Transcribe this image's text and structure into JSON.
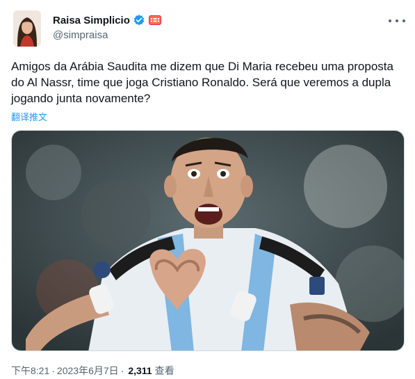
{
  "author": {
    "display_name": "Raisa Simplicio",
    "handle": "@simpraisa",
    "verified_icon": "verified-badge-icon",
    "affiliation_icon": "affiliate-badge-icon"
  },
  "tweet": {
    "text": "Amigos da Arábia Saudita me dizem que Di Maria recebeu uma proposta\ndo Al Nassr, time que joga Cristiano Ronaldo. Será que veremos a dupla\njogando junta novamente?",
    "translate_label": "翻译推文"
  },
  "meta": {
    "time": "下午8:21",
    "separator": "·",
    "date": "2023年6月7日",
    "views_count": "2,311",
    "views_label": "查看"
  },
  "colors": {
    "link": "#1d9bf0",
    "secondary_text": "#536471",
    "verified": "#1d9bf0",
    "affiliate": "#e0245e"
  }
}
